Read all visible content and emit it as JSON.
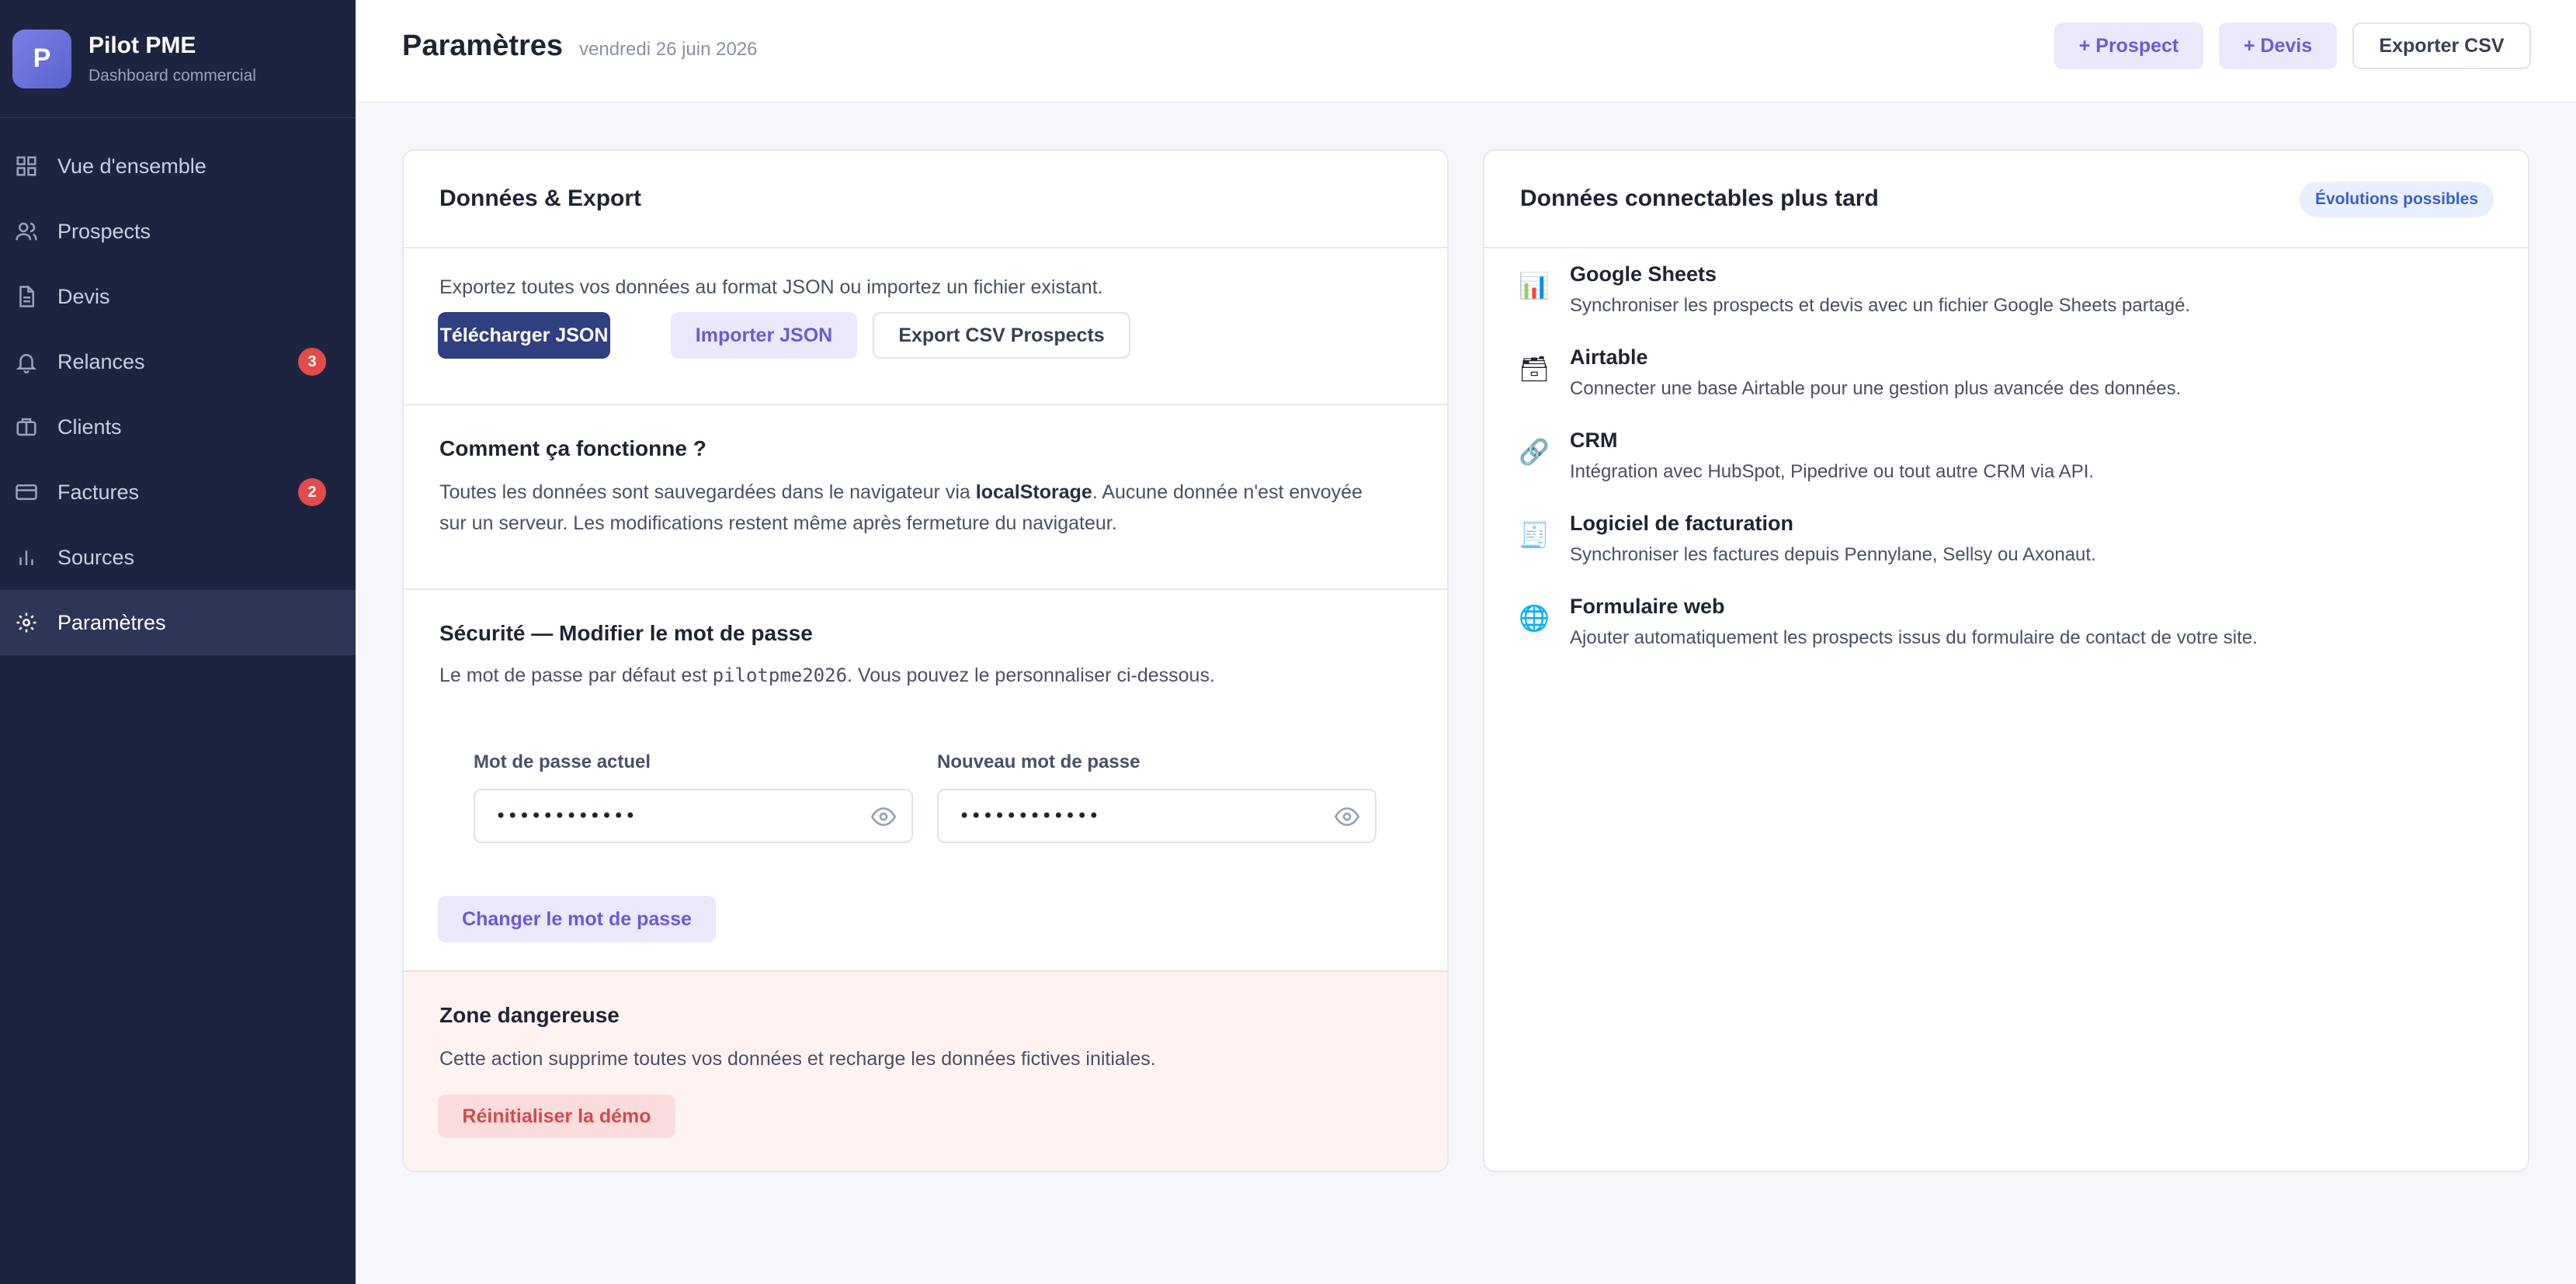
{
  "brand": {
    "logo_letter": "P",
    "name": "Pilot PME",
    "subtitle": "Dashboard commercial"
  },
  "sidebar": {
    "items": [
      {
        "label": "Vue d'ensemble",
        "icon": "grid-icon"
      },
      {
        "label": "Prospects",
        "icon": "users-icon"
      },
      {
        "label": "Devis",
        "icon": "document-icon"
      },
      {
        "label": "Relances",
        "icon": "bell-icon",
        "badge": "3"
      },
      {
        "label": "Clients",
        "icon": "briefcase-icon"
      },
      {
        "label": "Factures",
        "icon": "credit-card-icon",
        "badge": "2"
      },
      {
        "label": "Sources",
        "icon": "bar-chart-icon"
      },
      {
        "label": "Paramètres",
        "icon": "gear-icon",
        "active": true
      }
    ]
  },
  "header": {
    "title": "Paramètres",
    "date": "vendredi 26 juin 2026",
    "prospect_btn": "+ Prospect",
    "devis_btn": "+ Devis",
    "export_btn": "Exporter CSV"
  },
  "data_export": {
    "title": "Données & Export",
    "description": "Exportez toutes vos données au format JSON ou importez un fichier existant.",
    "download_json": "Télécharger JSON",
    "import_json": "Importer JSON",
    "export_csv_prospects": "Export CSV Prospects"
  },
  "how_it_works": {
    "title": "Comment ça fonctionne ?",
    "text_before": "Toutes les données sont sauvegardées dans le navigateur via ",
    "text_bold": "localStorage",
    "text_after": ". Aucune donnée n'est envoyée",
    "text_line2": "sur un serveur. Les modifications restent même après fermeture du navigateur."
  },
  "security": {
    "title": "Sécurité — Modifier le mot de passe",
    "text_before": "Le mot de passe par défaut est ",
    "default_password": "pilotpme2026",
    "text_after": ". Vous pouvez le personnaliser ci-dessous.",
    "current_label": "Mot de passe actuel",
    "current_value": "••••••••••••",
    "new_label": "Nouveau mot de passe",
    "new_value": "••••••••••••",
    "change_btn": "Changer le mot de passe"
  },
  "danger": {
    "title": "Zone dangereuse",
    "text": "Cette action supprime toutes vos données et recharge les données fictives initiales.",
    "reset_btn": "Réinitialiser la démo"
  },
  "integrations": {
    "title": "Données connectables plus tard",
    "badge": "Évolutions possibles",
    "items": [
      {
        "icon": "📊",
        "icon_name": "bar-chart-emoji-icon",
        "name": "Google Sheets",
        "desc": "Synchroniser les prospects et devis avec un fichier Google Sheets partagé."
      },
      {
        "icon": "🗃",
        "icon_name": "card-file-box-icon",
        "name": "Airtable",
        "desc": "Connecter une base Airtable pour une gestion plus avancée des données."
      },
      {
        "icon": "🔗",
        "icon_name": "link-icon",
        "name": "CRM",
        "desc": "Intégration avec HubSpot, Pipedrive ou tout autre CRM via API."
      },
      {
        "icon": "🧾",
        "icon_name": "receipt-icon",
        "name": "Logiciel de facturation",
        "desc": "Synchroniser les factures depuis Pennylane, Sellsy ou Axonaut."
      },
      {
        "icon": "🌐",
        "icon_name": "globe-icon",
        "name": "Formulaire web",
        "desc": "Ajouter automatiquement les prospects issus du formulaire de contact de votre site."
      }
    ]
  },
  "colors": {
    "sidebar_bg": "#1c2440",
    "accent": "#6a5bd6",
    "primary_dark": "#2f3f7f",
    "danger": "#d44a4a",
    "badge_red": "#e14b4b"
  }
}
